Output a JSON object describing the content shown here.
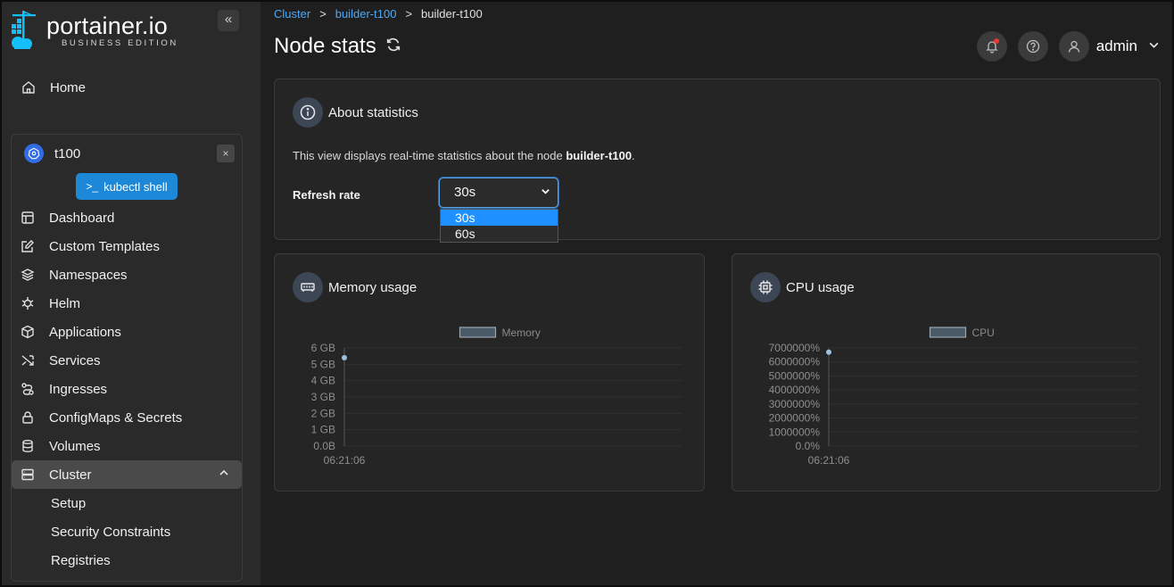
{
  "brand": {
    "name": "portainer.io",
    "edition": "BUSINESS EDITION"
  },
  "sidebar": {
    "collapse_icon": "«",
    "home_label": "Home",
    "environment": {
      "name": "t100",
      "kubectl_label": "kubectl shell",
      "close": "×"
    },
    "items": [
      {
        "label": "Dashboard",
        "icon": "layout-icon"
      },
      {
        "label": "Custom Templates",
        "icon": "edit-icon"
      },
      {
        "label": "Namespaces",
        "icon": "layers-icon"
      },
      {
        "label": "Helm",
        "icon": "helm-icon"
      },
      {
        "label": "Applications",
        "icon": "box-icon"
      },
      {
        "label": "Services",
        "icon": "shuffle-icon"
      },
      {
        "label": "Ingresses",
        "icon": "route-icon"
      },
      {
        "label": "ConfigMaps & Secrets",
        "icon": "lock-icon"
      },
      {
        "label": "Volumes",
        "icon": "database-icon"
      },
      {
        "label": "Cluster",
        "icon": "server-icon"
      }
    ],
    "cluster_sub": [
      "Setup",
      "Security Constraints",
      "Registries"
    ]
  },
  "header": {
    "breadcrumb": {
      "cluster": "Cluster",
      "node_link": "builder-t100",
      "current": "builder-t100",
      "sep": ">"
    },
    "title": "Node stats",
    "user": "admin"
  },
  "about": {
    "title": "About statistics",
    "text_prefix": "This view displays real-time statistics about the node ",
    "text_node": "builder-t100",
    "text_suffix": ".",
    "refresh_label": "Refresh rate",
    "refresh_value": "30s",
    "options": [
      "30s",
      "60s"
    ]
  },
  "memory_card": {
    "title": "Memory usage"
  },
  "cpu_card": {
    "title": "CPU usage"
  },
  "chart_data": [
    {
      "type": "line",
      "series": [
        {
          "name": "Memory",
          "x": [
            "06:21:06"
          ],
          "values": [
            5.4
          ]
        }
      ],
      "y_ticks": [
        "6 GB",
        "5 GB",
        "4 GB",
        "3 GB",
        "2 GB",
        "1 GB",
        "0.0B"
      ],
      "x_ticks": [
        "06:21:06"
      ],
      "ylim": [
        0,
        6
      ],
      "legend_position": "top-center",
      "colors": {
        "swatch_fill": "#4a5a66",
        "swatch_border": "#9aa7b2",
        "point": "#9ec0dc"
      }
    },
    {
      "type": "line",
      "series": [
        {
          "name": "CPU",
          "x": [
            "06:21:06"
          ],
          "values": [
            6700000
          ]
        }
      ],
      "y_ticks": [
        "7000000%",
        "6000000%",
        "5000000%",
        "4000000%",
        "3000000%",
        "2000000%",
        "1000000%",
        "0.0%"
      ],
      "x_ticks": [
        "06:21:06"
      ],
      "ylim": [
        0,
        7000000
      ],
      "legend_position": "top-center",
      "colors": {
        "swatch_fill": "#4a5a66",
        "swatch_border": "#9aa7b2",
        "point": "#9ec0dc"
      }
    }
  ]
}
